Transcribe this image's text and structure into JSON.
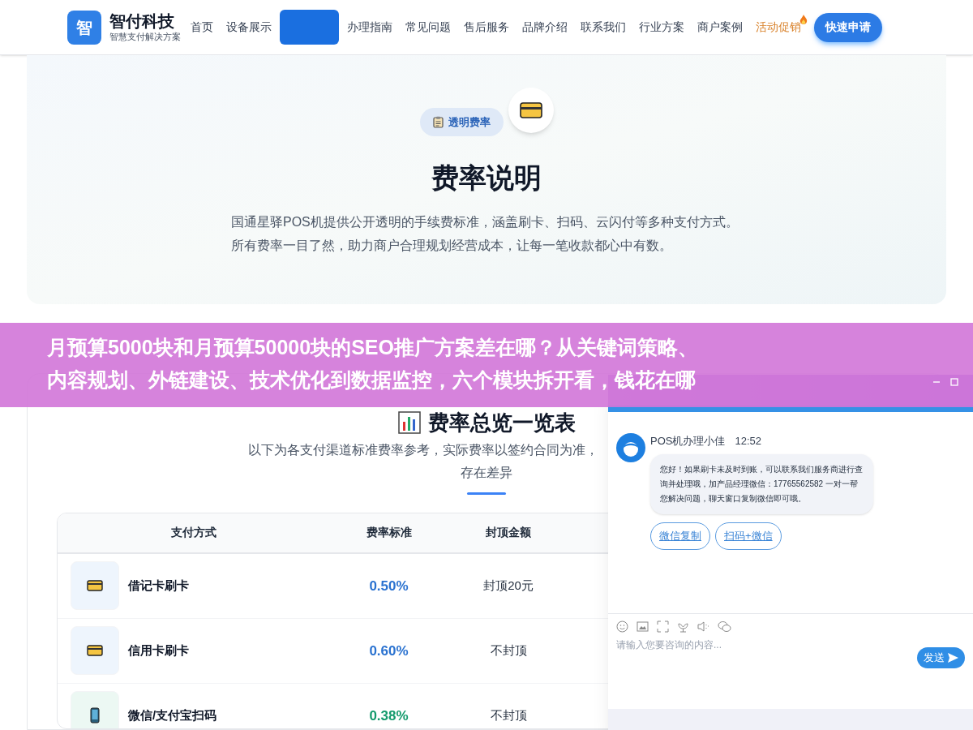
{
  "header": {
    "logo_mark": "智",
    "brand": "智付科技",
    "tagline": "智慧支付解决方案",
    "nav": [
      {
        "label": "首页",
        "selected": false,
        "kind": "normal"
      },
      {
        "label": "设备展示",
        "selected": false,
        "kind": "normal"
      },
      {
        "selected": true,
        "kind": "normal"
      },
      {
        "label": "办理指南",
        "selected": false,
        "kind": "normal"
      },
      {
        "label": "常见问题",
        "selected": false,
        "kind": "normal"
      },
      {
        "label": "售后服务",
        "selected": false,
        "kind": "normal"
      },
      {
        "label": "品牌介绍",
        "selected": false,
        "kind": "normal"
      },
      {
        "label": "联系我们",
        "selected": false,
        "kind": "normal"
      },
      {
        "label": "行业方案",
        "selected": false,
        "kind": "normal"
      },
      {
        "label": "商户案例",
        "selected": false,
        "kind": "normal"
      },
      {
        "label": "活动促销",
        "selected": false,
        "kind": "promo"
      }
    ],
    "cta": "快速申请"
  },
  "hero": {
    "badge": "透明费率",
    "title": "费率说明",
    "description": "国通星驿POS机提供公开透明的手续费标准，涵盖刷卡、扫码、云闪付等多种支付方式。所有费率一目了然，助力商户合理规划经营成本，让每一笔收款都心中有数。"
  },
  "rates": {
    "title": "费率总览一览表",
    "subtitle_lines": [
      "以下为各支付渠道标准费率参考，实际费率以签约合同为准，",
      "存在差异"
    ],
    "table": {
      "columns": [
        "支付方式",
        "费率标准",
        "封顶金额"
      ],
      "rows": [
        {
          "kind": "card",
          "name": "借记卡刷卡",
          "rate": "0.50%",
          "color": "#2a72d0",
          "cap": "封顶20元"
        },
        {
          "kind": "card",
          "name": "信用卡刷卡",
          "rate": "0.60%",
          "color": "#2a72d0",
          "cap": "不封顶"
        },
        {
          "kind": "phone",
          "name": "微信/支付宝扫码",
          "rate": "0.38%",
          "color": "#139a6c",
          "cap": "不封顶"
        }
      ]
    }
  },
  "banner": {
    "lines": [
      "月预算5000块和月预算50000块的SEO推广方案差在哪？从关键词策略、",
      "内容规划、外链建设、技术优化到数据监控，六个模块拆开看，钱花在哪"
    ]
  },
  "chat": {
    "agent": "POS机办理小佳",
    "time": "12:52",
    "message": "您好！如果刷卡未及时到账，可以联系我们服务商进行查询并处理哦，加产品经理微信：17765562582 一对一帮您解决问题，聊天窗口复制微信即可哦。",
    "actions": [
      "微信复制",
      "扫码+微信"
    ],
    "placeholder": "请输入您要咨询的内容...",
    "send": "发送"
  }
}
